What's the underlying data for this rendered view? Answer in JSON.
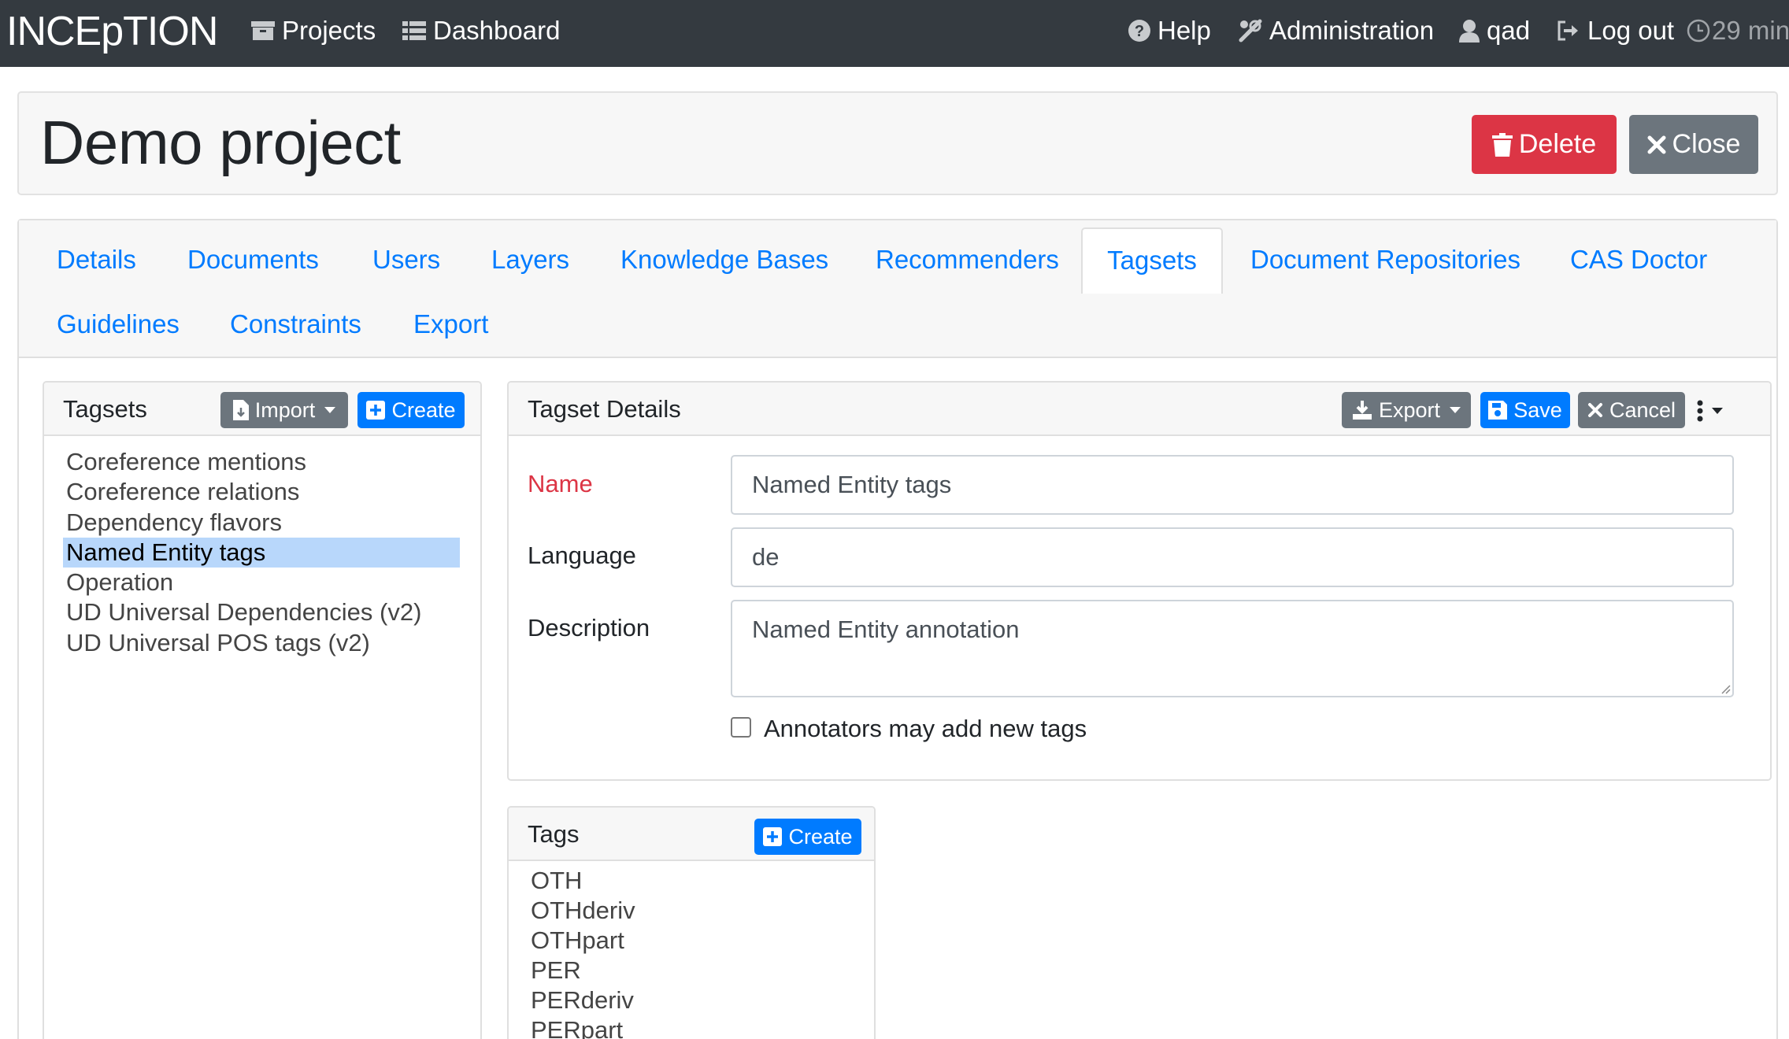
{
  "navbar": {
    "brand": "INCEpTION",
    "projects": "Projects",
    "dashboard": "Dashboard",
    "help": "Help",
    "administration": "Administration",
    "user": "qad",
    "logout": "Log out",
    "timer": "29 min"
  },
  "project": {
    "title": "Demo project",
    "delete_label": "Delete",
    "close_label": "Close"
  },
  "tabs": {
    "details": "Details",
    "documents": "Documents",
    "users": "Users",
    "layers": "Layers",
    "knowledge_bases": "Knowledge Bases",
    "recommenders": "Recommenders",
    "tagsets": "Tagsets",
    "document_repositories": "Document Repositories",
    "cas_doctor": "CAS Doctor",
    "guidelines": "Guidelines",
    "constraints": "Constraints",
    "export": "Export",
    "active": "Tagsets"
  },
  "tagsets_panel": {
    "title": "Tagsets",
    "import_label": "Import",
    "create_label": "Create",
    "items": [
      "Coreference mentions",
      "Coreference relations",
      "Dependency flavors",
      "Named Entity tags",
      "Operation",
      "UD Universal Dependencies (v2)",
      "UD Universal POS tags (v2)"
    ],
    "selected": "Named Entity tags"
  },
  "details_panel": {
    "title": "Tagset Details",
    "export_label": "Export",
    "save_label": "Save",
    "cancel_label": "Cancel",
    "name_label": "Name",
    "name_value": "Named Entity tags",
    "language_label": "Language",
    "language_value": "de",
    "description_label": "Description",
    "description_value": "Named Entity annotation",
    "checkbox_label": "Annotators may add new tags",
    "checkbox_checked": false
  },
  "tags_panel": {
    "title": "Tags",
    "create_label": "Create",
    "items": [
      "OTH",
      "OTHderiv",
      "OTHpart",
      "PER",
      "PERderiv",
      "PERpart"
    ]
  },
  "colors": {
    "navbar": "#343a40",
    "primary": "#007bff",
    "danger": "#dc3545",
    "secondary": "#6c757d",
    "selected_row": "#b8d7fb"
  }
}
